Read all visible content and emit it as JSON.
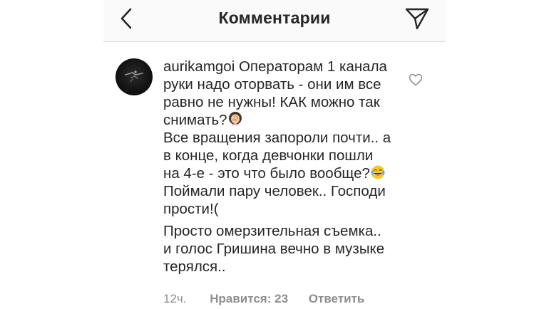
{
  "header": {
    "title": "Комментарии",
    "back_icon": "chevron-left-icon",
    "share_icon": "paper-plane-icon"
  },
  "comment": {
    "username": "aurikamgoi",
    "part1": " Операторам 1 канала руки надо оторвать - они им все равно не нужны! КАК можно так снимать?",
    "part2": "Все вращения запороли почти.. а в конце, когда девчонки пошли на 4-е - это что было вообще?",
    "part3": " Поймали пару человек.. Господи прости!(",
    "paragraph2": "Просто омерзительная съемка.. и голос Гришина вечно в музыке терялся..",
    "emoji1": "woman-facepalming-emoji",
    "emoji2": "tears-of-joy-emoji",
    "time": "12ч.",
    "likes": "Нравится: 23",
    "reply": "Ответить",
    "like_icon": "heart-outline-icon"
  },
  "colors": {
    "text": "#262626",
    "secondary": "#8e8e8e",
    "header_bg": "#fafafa",
    "divider": "#dbdbdb"
  }
}
